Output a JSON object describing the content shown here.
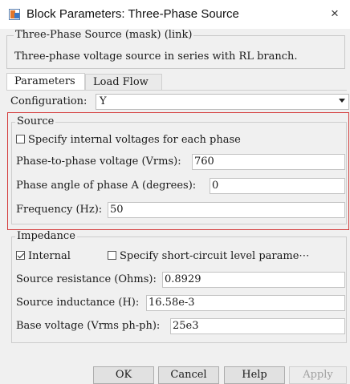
{
  "window": {
    "title": "Block Parameters: Three-Phase Source",
    "close_glyph": "×"
  },
  "mask": {
    "legend": "Three-Phase Source (mask) (link)",
    "description": "Three-phase voltage source in series with RL branch."
  },
  "tabs": [
    {
      "label": "Parameters",
      "active": true
    },
    {
      "label": "Load Flow",
      "active": false
    }
  ],
  "configuration": {
    "label": "Configuration:",
    "value": "Y"
  },
  "source": {
    "legend": "Source",
    "specify_internal": {
      "label": "Specify internal voltages for each phase",
      "checked": false
    },
    "phase_voltage": {
      "label": "Phase-to-phase voltage (Vrms):",
      "value": "760"
    },
    "phase_angle": {
      "label": "Phase angle of phase A (degrees):",
      "value": "0"
    },
    "frequency": {
      "label": "Frequency (Hz):",
      "value": "50"
    }
  },
  "impedance": {
    "legend": "Impedance",
    "internal": {
      "label": "Internal",
      "checked": true
    },
    "short_circuit": {
      "label": "Specify short-circuit level parame⋯",
      "checked": false
    },
    "resistance": {
      "label": "Source resistance (Ohms):",
      "value": "0.8929"
    },
    "inductance": {
      "label": "Source inductance (H):",
      "value": "16.58e-3"
    },
    "base_voltage": {
      "label": "Base voltage (Vrms ph-ph):",
      "value": "25e3"
    }
  },
  "buttons": {
    "ok": "OK",
    "cancel": "Cancel",
    "help": "Help",
    "apply": "Apply"
  },
  "colors": {
    "highlight_border": "#d43c3c",
    "background": "#f0f0f0"
  }
}
